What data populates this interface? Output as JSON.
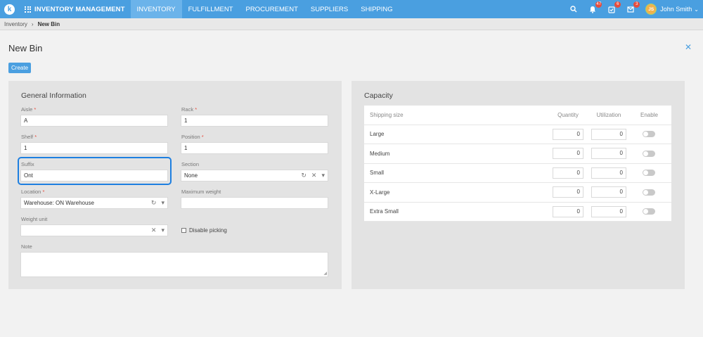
{
  "header": {
    "brand": "INVENTORY MANAGEMENT",
    "logo_letter": "k",
    "tabs": [
      "INVENTORY",
      "FULFILLMENT",
      "PROCUREMENT",
      "SUPPLIERS",
      "SHIPPING"
    ],
    "active_tab": "INVENTORY",
    "notifications_count": "47",
    "tasks_count": "6",
    "messages_count": "3",
    "avatar_initials": "JS",
    "user_name": "John Smith",
    "accent_color": "#4a9fe0"
  },
  "breadcrumb": {
    "root": "Inventory",
    "current": "New Bin"
  },
  "page": {
    "title": "New Bin",
    "create_label": "Create"
  },
  "general": {
    "title": "General Information",
    "aisle": {
      "label": "Aisle",
      "value": "A"
    },
    "rack": {
      "label": "Rack",
      "value": "1"
    },
    "shelf": {
      "label": "Shelf",
      "value": "1"
    },
    "position": {
      "label": "Position",
      "value": "1"
    },
    "suffix": {
      "label": "Suffix",
      "value": "Ont"
    },
    "section": {
      "label": "Section",
      "value": "None"
    },
    "location": {
      "label": "Location",
      "value": "Warehouse: ON Warehouse"
    },
    "max_weight": {
      "label": "Maximum weight",
      "value": ""
    },
    "weight_unit": {
      "label": "Weight unit",
      "value": ""
    },
    "disable_picking": {
      "label": "Disable picking",
      "checked": false
    },
    "note": {
      "label": "Note",
      "value": ""
    }
  },
  "capacity": {
    "title": "Capacity",
    "headers": {
      "size": "Shipping size",
      "quantity": "Quantity",
      "utilization": "Utilization",
      "enable": "Enable"
    },
    "rows": [
      {
        "size": "Large",
        "quantity": "0",
        "utilization": "0",
        "enabled": false
      },
      {
        "size": "Medium",
        "quantity": "0",
        "utilization": "0",
        "enabled": false
      },
      {
        "size": "Small",
        "quantity": "0",
        "utilization": "0",
        "enabled": false
      },
      {
        "size": "X-Large",
        "quantity": "0",
        "utilization": "0",
        "enabled": false
      },
      {
        "size": "Extra Small",
        "quantity": "0",
        "utilization": "0",
        "enabled": false
      }
    ]
  }
}
